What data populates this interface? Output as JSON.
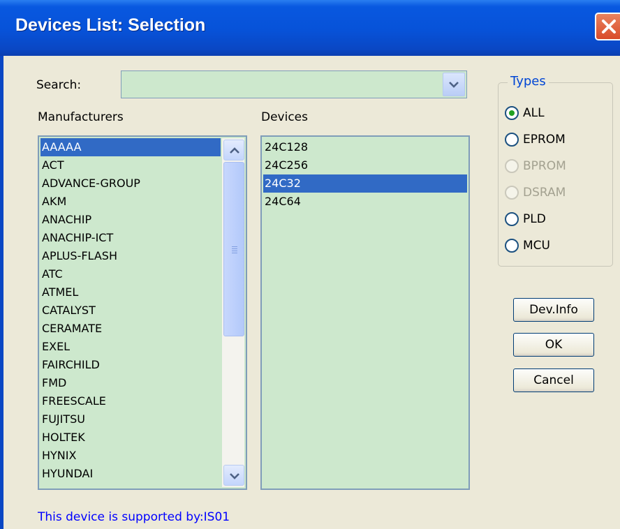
{
  "window": {
    "title": "Devices List: Selection"
  },
  "search": {
    "label": "Search:",
    "value": ""
  },
  "manufacturers": {
    "label": "Manufacturers",
    "items": [
      "AAAAA",
      "ACT",
      "ADVANCE-GROUP",
      "AKM",
      "ANACHIP",
      "ANACHIP-ICT",
      "APLUS-FLASH",
      "ATC",
      "ATMEL",
      "CATALYST",
      "CERAMATE",
      "EXEL",
      "FAIRCHILD",
      "FMD",
      "FREESCALE",
      "FUJITSU",
      "HOLTEK",
      "HYNIX",
      "HYUNDAI"
    ],
    "selected": "AAAAA"
  },
  "devices": {
    "label": "Devices",
    "items": [
      "24C128",
      "24C256",
      "24C32",
      "24C64"
    ],
    "selected": "24C32"
  },
  "types": {
    "title": "Types",
    "options": [
      {
        "label": "ALL",
        "checked": true,
        "enabled": true
      },
      {
        "label": "EPROM",
        "checked": false,
        "enabled": true
      },
      {
        "label": "BPROM",
        "checked": false,
        "enabled": false
      },
      {
        "label": "DSRAM",
        "checked": false,
        "enabled": false
      },
      {
        "label": "PLD",
        "checked": false,
        "enabled": true
      },
      {
        "label": "MCU",
        "checked": false,
        "enabled": true
      }
    ]
  },
  "buttons": {
    "dev_info": "Dev.Info",
    "ok": "OK",
    "cancel": "Cancel"
  },
  "status": "This device is supported by:IS01",
  "colors": {
    "list_bg": "#cde8cd",
    "selection": "#316ac5",
    "titlebar": "#0752d8",
    "status_text": "#0000ff",
    "group_title": "#0046d5"
  },
  "icons": {
    "close": "close-icon",
    "dropdown": "chevron-down-icon",
    "scroll_up": "scroll-up-arrow-icon",
    "scroll_down": "scroll-down-arrow-icon"
  }
}
